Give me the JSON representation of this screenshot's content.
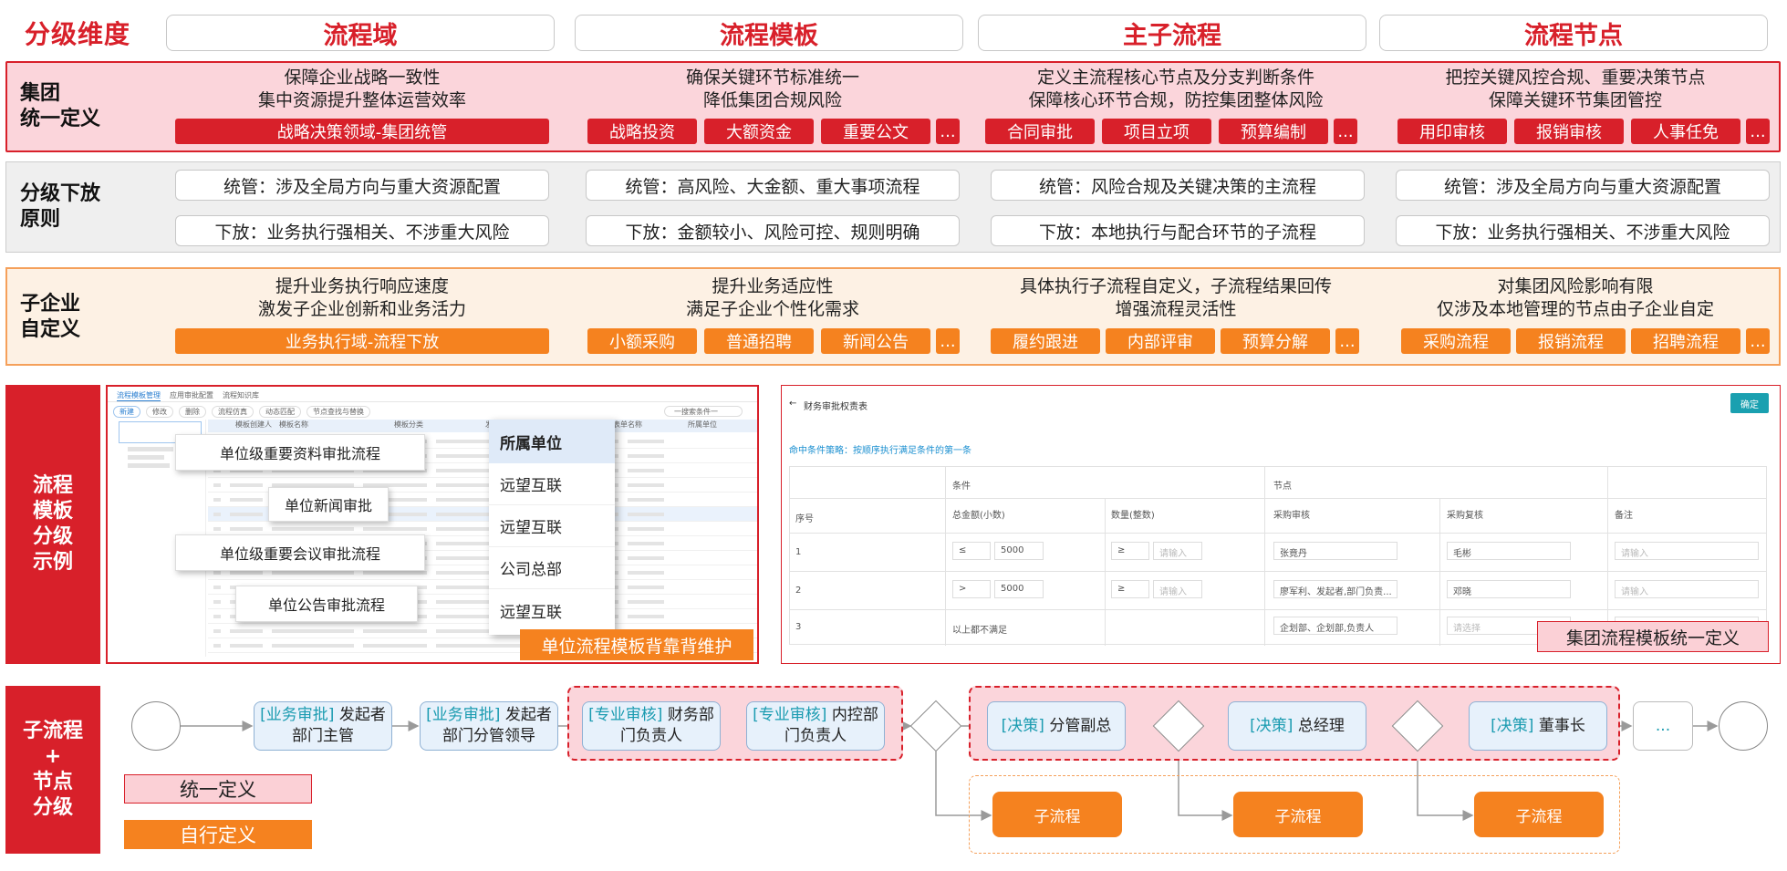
{
  "header": {
    "title": "分级维度",
    "cols": [
      "流程域",
      "流程模板",
      "主子流程",
      "流程节点"
    ]
  },
  "group": {
    "label": "集团\n统一定义",
    "cols": [
      {
        "desc": "保障企业战略一致性\n集中资源提升整体运营效率",
        "tags": [
          "战略决策领域-集团统管"
        ]
      },
      {
        "desc": "确保关键环节标准统一\n降低集团合规风险",
        "tags": [
          "战略投资",
          "大额资金",
          "重要公文",
          "..."
        ]
      },
      {
        "desc": "定义主流程核心节点及分支判断条件\n保障核心环节合规，防控集团整体风险",
        "tags": [
          "合同审批",
          "项目立项",
          "预算编制",
          "..."
        ]
      },
      {
        "desc": "把控关键风控合规、重要决策节点\n保障关键环节集团管控",
        "tags": [
          "用印审核",
          "报销审核",
          "人事任免",
          "..."
        ]
      }
    ]
  },
  "principle": {
    "label": "分级下放\n原则",
    "cols": [
      {
        "top": "统管：涉及全局方向与重大资源配置",
        "bottom": "下放：业务执行强相关、不涉重大风险"
      },
      {
        "top": "统管：高风险、大金额、重大事项流程",
        "bottom": "下放：金额较小、风险可控、规则明确"
      },
      {
        "top": "统管：风险合规及关键决策的主流程",
        "bottom": "下放：本地执行与配合环节的子流程"
      },
      {
        "top": "统管：涉及全局方向与重大资源配置",
        "bottom": "下放：业务执行强相关、不涉重大风险"
      }
    ]
  },
  "sub": {
    "label": "子企业\n自定义",
    "cols": [
      {
        "desc": "提升业务执行响应速度\n激发子企业创新和业务活力",
        "tags": [
          "业务执行域-流程下放"
        ]
      },
      {
        "desc": "提升业务适应性\n满足子企业个性化需求",
        "tags": [
          "小额采购",
          "普通招聘",
          "新闻公告",
          "..."
        ]
      },
      {
        "desc": "具体执行子流程自定义，子流程结果回传\n增强流程灵活性",
        "tags": [
          "履约跟进",
          "内部评审",
          "预算分解",
          "..."
        ]
      },
      {
        "desc": "对集团风险影响有限\n仅涉及本地管理的节点由子企业自定",
        "tags": [
          "采购流程",
          "报销流程",
          "招聘流程",
          "..."
        ]
      }
    ]
  },
  "example": {
    "label": "流程\n模板\n分级\n示例",
    "left": {
      "tabs": [
        "流程模板管理",
        "应用审批配置",
        "流程知识库"
      ],
      "toolbar": [
        "新建",
        "修改",
        "删除",
        "流程仿真",
        "动态匹配",
        "节点查找与替换"
      ],
      "search": "一搜索条件一",
      "cols": [
        "模板创建人",
        "模板名称",
        "模板分类",
        "发布",
        "",
        "表单名称",
        "所属单位"
      ],
      "cards": [
        "单位级重要资料审批流程",
        "单位新闻审批",
        "单位级重要会议审批流程",
        "单位公告审批流程"
      ],
      "popup_head": "所属单位",
      "popup_items": [
        "远望互联",
        "远望互联",
        "公司总部",
        "远望互联"
      ],
      "caption": "单位流程模板背靠背维护"
    },
    "right": {
      "title": "财务审批权责表",
      "confirm": "确定",
      "strategy": "命中条件策略：按顺序执行满足条件的第一条",
      "head1": [
        "条件",
        "节点"
      ],
      "head2": [
        "序号",
        "总金额(小数)",
        "数量(整数)",
        "采购审核",
        "采购复核",
        "备注"
      ],
      "rows": [
        [
          "1",
          "≤",
          "5000",
          "≥",
          "请输入",
          "张竟丹",
          "毛彬",
          "请输入"
        ],
        [
          "2",
          ">",
          "5000",
          "≥",
          "请输入",
          "廖军利、发起者,部门负责...",
          "邓晓",
          "请输入"
        ],
        [
          "3",
          "以上都不满足",
          "",
          "",
          "",
          "企划部、企划部,负责人",
          "请选择",
          "请输入"
        ]
      ],
      "caption": "集团流程模板统一定义"
    }
  },
  "flow": {
    "label": "子流程\n+\n节点\n分级",
    "nodes": [
      {
        "k": "[业务审批]",
        "t": " 发起者部门主管"
      },
      {
        "k": "[业务审批]",
        "t": " 发起者部门分管领导"
      },
      {
        "k": "[专业审核]",
        "t": " 财务部门负责人"
      },
      {
        "k": "[专业审核]",
        "t": " 内控部门负责人"
      },
      {
        "k": "[决策]",
        "t": " 分管副总"
      },
      {
        "k": "[决策]",
        "t": " 总经理"
      },
      {
        "k": "[决策]",
        "t": " 董事长"
      }
    ],
    "more": "...",
    "subflow": "子流程",
    "legend": [
      "统一定义",
      "自行定义"
    ]
  },
  "colors": {
    "red": "#d8202a",
    "orange": "#f5821f",
    "pink": "#fbd0d6",
    "lightOrange": "#fdf1e4"
  }
}
